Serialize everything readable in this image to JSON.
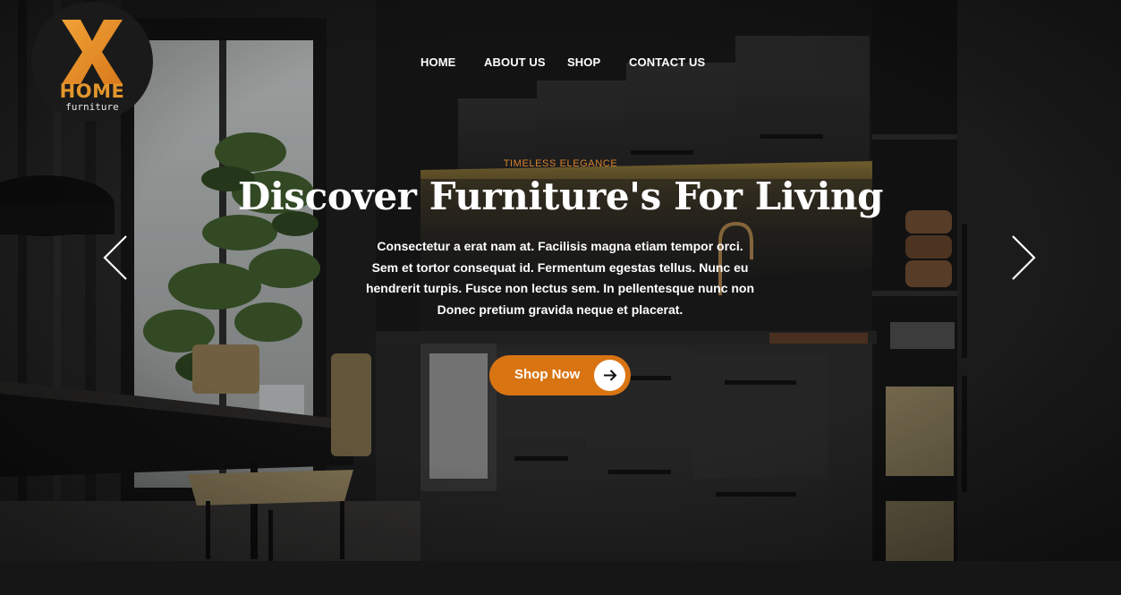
{
  "brand": {
    "logo_letter": "X",
    "logo_word": "HOME",
    "logo_sub": "furniture",
    "accent_color": "#d97412",
    "eyebrow_color": "#d9822b"
  },
  "nav": {
    "items": [
      {
        "label": "HOME"
      },
      {
        "label": "ABOUT US"
      },
      {
        "label": "SHOP"
      },
      {
        "label": "CONTACT US"
      }
    ]
  },
  "hero": {
    "eyebrow": "TIMELESS ELEGANCE",
    "title": "Discover Furniture's For Living",
    "description": "Consectetur a erat nam at. Facilisis magna etiam tempor orci. Sem et tortor consequat id. Fermentum egestas tellus. Nunc eu hendrerit turpis. Fusce non lectus sem. In pellentesque nunc non Donec pretium gravida neque et placerat.",
    "cta_label": "Shop Now",
    "cta_icon": "arrow-right-icon",
    "prev_icon": "chevron-left-icon",
    "next_icon": "chevron-right-icon",
    "background": "kitchen-photo"
  }
}
